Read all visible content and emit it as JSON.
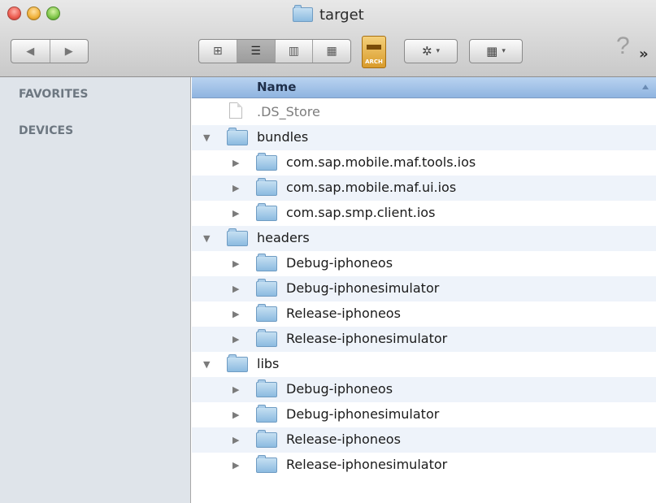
{
  "window": {
    "title": "target",
    "title_icon": "folder-icon"
  },
  "toolbar": {
    "back_icon": "◀",
    "forward_icon": "▶",
    "view_icons": [
      "⊞",
      "☰",
      "▥",
      "▦"
    ],
    "archive_label": "ARCH",
    "action_icon": "✲",
    "arrange_icon": "▦",
    "caret": "▾",
    "help": "?",
    "overflow": "»"
  },
  "sidebar": {
    "sections": [
      "FAVORITES",
      "DEVICES"
    ]
  },
  "list": {
    "header": "Name",
    "rows": [
      {
        "name": ".DS_Store",
        "type": "file",
        "level": 0,
        "expanded": false
      },
      {
        "name": "bundles",
        "type": "folder",
        "level": 0,
        "expanded": true
      },
      {
        "name": "com.sap.mobile.maf.tools.ios",
        "type": "folder",
        "level": 1,
        "expanded": false
      },
      {
        "name": "com.sap.mobile.maf.ui.ios",
        "type": "folder",
        "level": 1,
        "expanded": false
      },
      {
        "name": "com.sap.smp.client.ios",
        "type": "folder",
        "level": 1,
        "expanded": false
      },
      {
        "name": "headers",
        "type": "folder",
        "level": 0,
        "expanded": true
      },
      {
        "name": "Debug-iphoneos",
        "type": "folder",
        "level": 1,
        "expanded": false
      },
      {
        "name": "Debug-iphonesimulator",
        "type": "folder",
        "level": 1,
        "expanded": false
      },
      {
        "name": "Release-iphoneos",
        "type": "folder",
        "level": 1,
        "expanded": false
      },
      {
        "name": "Release-iphonesimulator",
        "type": "folder",
        "level": 1,
        "expanded": false
      },
      {
        "name": "libs",
        "type": "folder",
        "level": 0,
        "expanded": true
      },
      {
        "name": "Debug-iphoneos",
        "type": "folder",
        "level": 1,
        "expanded": false
      },
      {
        "name": "Debug-iphonesimulator",
        "type": "folder",
        "level": 1,
        "expanded": false
      },
      {
        "name": "Release-iphoneos",
        "type": "folder",
        "level": 1,
        "expanded": false
      },
      {
        "name": "Release-iphonesimulator",
        "type": "folder",
        "level": 1,
        "expanded": false
      }
    ]
  }
}
